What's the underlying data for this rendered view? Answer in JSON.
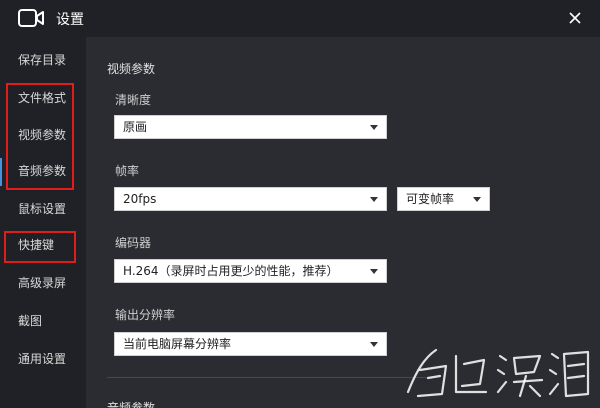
{
  "window": {
    "title": "设置",
    "icon": "camera-icon"
  },
  "sidebar": {
    "items": [
      {
        "label": "保存目录"
      },
      {
        "label": "文件格式"
      },
      {
        "label": "视频参数"
      },
      {
        "label": "音频参数"
      },
      {
        "label": "鼠标设置"
      },
      {
        "label": "快捷键"
      },
      {
        "label": "高级录屏"
      },
      {
        "label": "截图"
      },
      {
        "label": "通用设置"
      }
    ]
  },
  "content": {
    "section_title": "视频参数",
    "clarity": {
      "label": "清晰度",
      "value": "原画"
    },
    "framerate": {
      "label": "帧率",
      "value": "20fps",
      "mode": "可变帧率"
    },
    "encoder": {
      "label": "编码器",
      "value": "H.264（录屏时占用更少的性能，推荐）"
    },
    "resolution": {
      "label": "输出分辨率",
      "value": "当前电脑屏幕分辨率"
    },
    "next_section_title": "音频参数"
  },
  "highlight_color": "#e41b1b",
  "accent_color": "#4a90e2"
}
